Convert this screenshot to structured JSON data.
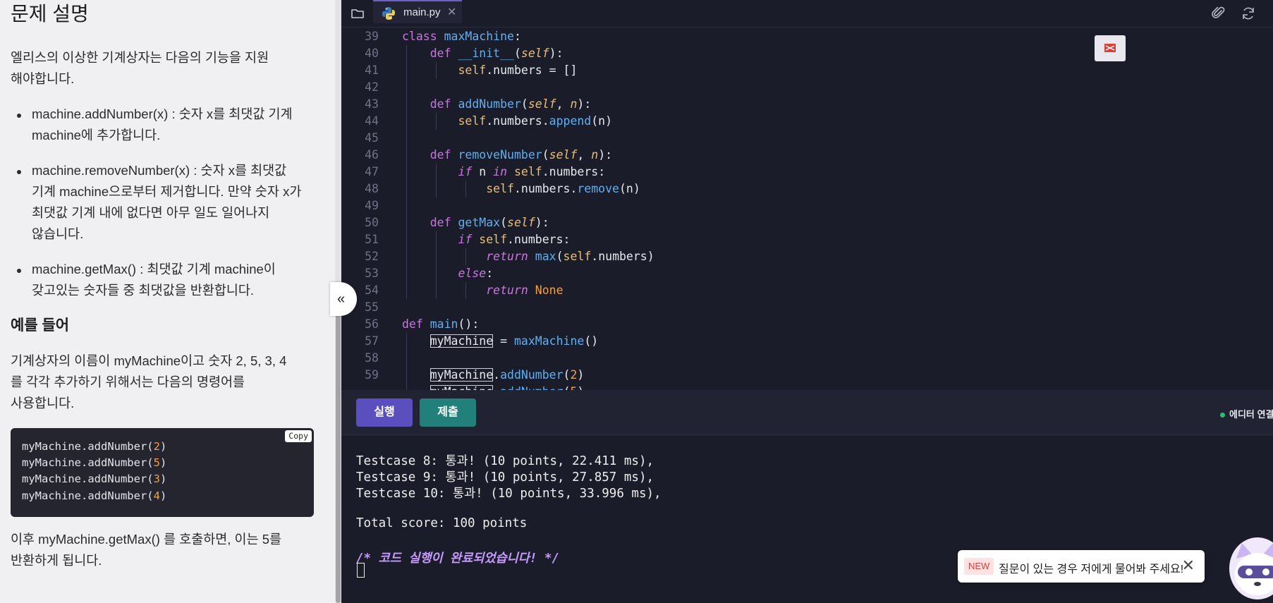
{
  "problem": {
    "title": "문제 설명",
    "intro_lines": [
      "엘리스의 이상한 기계상자는 다음의 기능을 지원",
      "해야합니다."
    ],
    "bullets": [
      {
        "lines": [
          "machine.addNumber(x) : 숫자 x를 최댓값 기계",
          "machine에 추가합니다."
        ]
      },
      {
        "lines": [
          "machine.removeNumber(x) : 숫자 x를 최댓값",
          "기계 machine으로부터 제거합니다. 만약 숫자 x가",
          "최댓값 기계 내에 없다면 아무 일도 일어나지",
          "않습니다."
        ]
      },
      {
        "lines": [
          "machine.getMax() : 최댓값 기계 machine이",
          "갖고있는 숫자들 중 최댓값을 반환합니다."
        ]
      }
    ],
    "example_heading": "예를 들어",
    "example_lines": [
      "기계상자의 이름이 myMachine이고 숫자 2, 5, 3, 4",
      "를 각각 추가하기 위해서는 다음의 명령어를",
      "사용합니다."
    ],
    "example_code": [
      {
        "prefix": "myMachine.addNumber(",
        "arg": "2",
        "suffix": ")"
      },
      {
        "prefix": "myMachine.addNumber(",
        "arg": "5",
        "suffix": ")"
      },
      {
        "prefix": "myMachine.addNumber(",
        "arg": "3",
        "suffix": ")"
      },
      {
        "prefix": "myMachine.addNumber(",
        "arg": "4",
        "suffix": ")"
      }
    ],
    "copy_label": "Copy",
    "after_lines": [
      "이후 myMachine.getMax() 를 호출하면, 이는 5를",
      "반환하게 됩니다."
    ]
  },
  "editor": {
    "tab_label": "main.py",
    "tab_close": "✕",
    "line_numbers": [
      "39",
      "40",
      "41",
      "42",
      "43",
      "44",
      "45",
      "46",
      "47",
      "48",
      "49",
      "50",
      "51",
      "52",
      "53",
      "54",
      "55",
      "56",
      "57",
      "58",
      "59"
    ]
  },
  "runbar": {
    "run_label": "실행",
    "submit_label": "제출",
    "status_label": "에디터 연결"
  },
  "output": {
    "lines": [
      "Testcase 8: 통과! (10 points, 22.411 ms),",
      "Testcase 9: 통과! (10 points, 27.857 ms),",
      "Testcase 10: 통과! (10 points, 33.996 ms),",
      "Total score: 100 points"
    ],
    "completion": "/* 코드 실행이 완료되었습니다! */"
  },
  "chat": {
    "badge": "NEW",
    "text": "질문이 있는 경우 저에게 물어봐 주세요!",
    "close": "✕"
  },
  "collapse_icon": "«",
  "icons": [
    "folder-icon",
    "python-icon",
    "paperclip-icon",
    "refresh-icon",
    "collapse-icon",
    "close-icon",
    "chatbot-avatar-icon"
  ],
  "colors": {
    "accent": "#5b4fc0",
    "submit": "#21807a",
    "status_ok": "#27c06b"
  }
}
